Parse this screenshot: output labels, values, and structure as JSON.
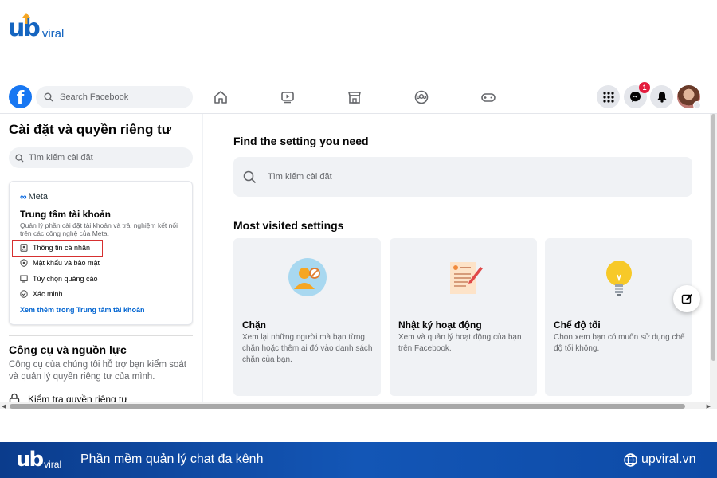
{
  "brand": {
    "logo_mark": "ub",
    "logo_word": "viral"
  },
  "topbar": {
    "search_placeholder": "Search Facebook",
    "notification_count": "1",
    "nav_icons": [
      "home-icon",
      "watch-icon",
      "marketplace-icon",
      "groups-icon",
      "gaming-icon"
    ],
    "right_icons": [
      "menu-grid-icon",
      "messenger-icon",
      "bell-icon",
      "avatar"
    ]
  },
  "sidebar": {
    "title": "Cài đặt và quyền riêng tư",
    "search_placeholder": "Tìm kiếm cài đặt",
    "meta_brand": "Meta",
    "accounts_center": {
      "title": "Trung tâm tài khoản",
      "description": "Quản lý phần cài đặt tài khoản và trải nghiệm kết nối trên các công nghệ của Meta.",
      "items": [
        {
          "label": "Thông tin cá nhân",
          "icon": "id-card-icon"
        },
        {
          "label": "Mật khẩu và bảo mật",
          "icon": "shield-icon"
        },
        {
          "label": "Tùy chọn quảng cáo",
          "icon": "monitor-icon"
        },
        {
          "label": "Xác minh",
          "icon": "check-circle-icon"
        }
      ],
      "link": "Xem thêm trong Trung tâm tài khoản"
    },
    "tools": {
      "title": "Công cụ và nguồn lực",
      "description": "Công cụ của chúng tôi hỗ trợ bạn kiểm soát và quản lý quyền riêng tư của mình.",
      "item": "Kiểm tra quyền riêng tư"
    }
  },
  "main": {
    "find_title": "Find the setting you need",
    "search_placeholder": "Tìm kiếm cài đặt",
    "most_visited_title": "Most visited settings",
    "cards": [
      {
        "title": "Chặn",
        "description": "Xem lại những người mà bạn từng chặn hoặc thêm ai đó vào danh sách chặn của bạn.",
        "icon": "block-user-icon"
      },
      {
        "title": "Nhật ký hoạt động",
        "description": "Xem và quản lý hoạt động của bạn trên Facebook.",
        "icon": "activity-log-icon"
      },
      {
        "title": "Chế độ tối",
        "description": "Chọn xem bạn có muốn sử dụng chế độ tối không.",
        "icon": "lightbulb-icon"
      }
    ]
  },
  "banner": {
    "logo_mark": "ub",
    "logo_word": "viral",
    "slogan": "Phần mềm quản lý chat đa kênh",
    "site": "upviral.vn"
  },
  "colors": {
    "facebook_blue": "#1877f2",
    "brand_blue": "#1565c0",
    "highlight_red": "#d63030"
  }
}
